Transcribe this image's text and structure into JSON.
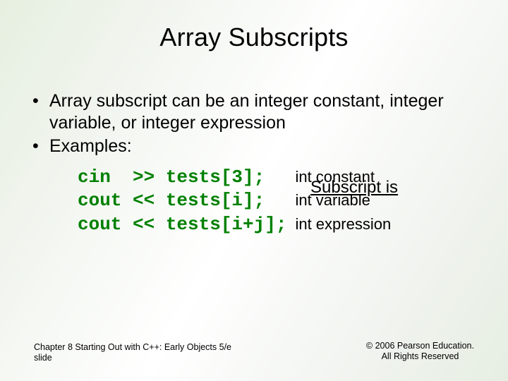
{
  "title": "Array Subscripts",
  "bullets": [
    "Array subscript can be an integer constant, integer variable, or integer expression",
    "Examples:"
  ],
  "subscript_header": "Subscript is",
  "examples": [
    {
      "code": "cin  >> tests[3];  ",
      "desc": " int constant"
    },
    {
      "code": "cout << tests[i];  ",
      "desc": " int variable"
    },
    {
      "code": "cout << tests[i+j];",
      "desc": " int expression"
    }
  ],
  "footer": {
    "left_line1": "Chapter 8 Starting Out with C++: Early Objects 5/e",
    "left_line2": "slide",
    "right_line1": "© 2006 Pearson Education.",
    "right_line2": "All Rights Reserved"
  }
}
